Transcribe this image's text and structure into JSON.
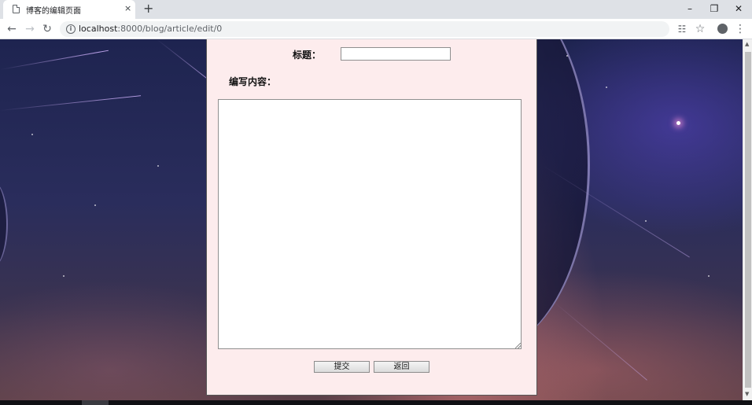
{
  "browser": {
    "tab_title": "博客的编辑页面",
    "tab_close_glyph": "×",
    "new_tab_glyph": "+",
    "window_min_glyph": "–",
    "window_max_glyph": "❐",
    "window_close_glyph": "✕",
    "url_host": "localhost",
    "url_path": ":8000/blog/article/edit/0",
    "icons": {
      "back": "arrow-left-icon",
      "forward": "arrow-right-icon",
      "reload": "reload-icon",
      "info": "info-icon",
      "translate": "translate-icon",
      "bookmark": "star-icon",
      "profile": "account-icon",
      "menu": "kebab-menu-icon"
    }
  },
  "form": {
    "title_label": "标题：",
    "title_value": "",
    "content_label": "编写内容：",
    "content_value": "",
    "submit_label": "提交",
    "back_label": "返回"
  },
  "colors": {
    "panel_background": "#fdeced",
    "panel_border": "#555555"
  }
}
